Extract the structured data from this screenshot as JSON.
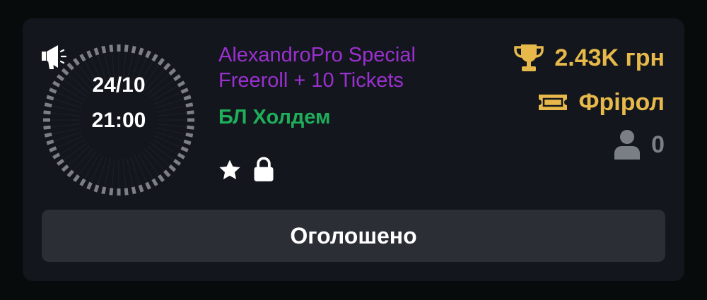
{
  "tournament": {
    "date": "24/10",
    "time": "21:00",
    "title_line1": "AlexandroPro Special",
    "title_line2": "Freeroll + 10 Tickets",
    "game_type": "БЛ Холдем",
    "prize": "2.43K грн",
    "tournament_type": "Фрірол",
    "players": "0",
    "status_button": "Оголошено"
  },
  "icons": {
    "clock_status": "megaphone-icon",
    "favorite": "star-icon",
    "private": "lock-icon",
    "prize": "trophy-icon",
    "type": "ticket-icon",
    "players": "user-icon"
  },
  "colors": {
    "background": "#070b0b",
    "card": "#13171d",
    "title": "#9b30d0",
    "game_type": "#1fae5a",
    "gold": "#e7b94a",
    "muted": "#7a7f86",
    "button": "#2b2e35",
    "dial_ticks": "#7d7f84"
  }
}
